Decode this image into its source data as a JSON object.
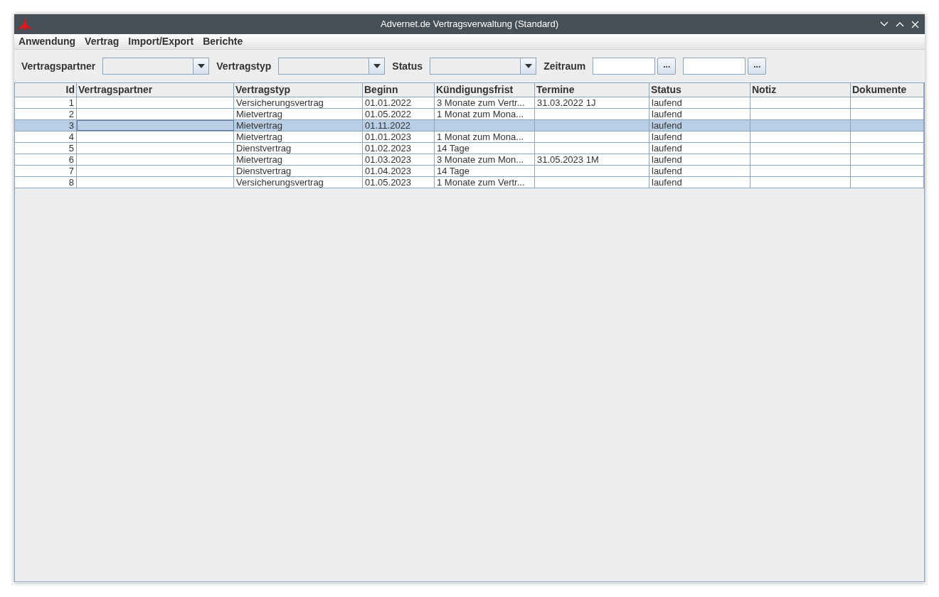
{
  "window": {
    "title": "Advernet.de Vertragsverwaltung (Standard)"
  },
  "menu": [
    "Anwendung",
    "Vertrag",
    "Import/Export",
    "Berichte"
  ],
  "filters": [
    {
      "label": "Vertragspartner",
      "kind": "combo"
    },
    {
      "label": "Vertragstyp",
      "kind": "combo"
    },
    {
      "label": "Status",
      "kind": "combo"
    },
    {
      "label": "Zeitraum",
      "kind": "range",
      "buttons": [
        "...",
        "..."
      ]
    }
  ],
  "table": {
    "columns": [
      "Id",
      "Vertragspartner",
      "Vertragstyp",
      "Beginn",
      "Kündigungsfrist",
      "Termine",
      "Status",
      "Notiz",
      "Dokumente"
    ],
    "rows": [
      {
        "selected": false,
        "id": "1",
        "vertragstyp": "Versicherungsvertrag",
        "beginn": "01.01.2022",
        "kuendigungsfrist": "3 Monate zum Vertr...",
        "termine": "31.03.2022 1J",
        "status": "laufend"
      },
      {
        "selected": false,
        "id": "2",
        "vertragstyp": "Mietvertrag",
        "beginn": "01.05.2022",
        "kuendigungsfrist": "1 Monat zum Mona...",
        "status": "laufend"
      },
      {
        "selected": true,
        "id": "3",
        "vertragstyp": "Mietvertrag",
        "beginn": "01.11.2022",
        "status": "laufend"
      },
      {
        "selected": false,
        "id": "4",
        "vertragstyp": "Mietvertrag",
        "beginn": "01.01.2023",
        "kuendigungsfrist": "1 Monat zum Mona...",
        "status": "laufend"
      },
      {
        "selected": false,
        "id": "5",
        "vertragstyp": "Dienstvertrag",
        "beginn": "01.02.2023",
        "kuendigungsfrist": "14 Tage",
        "status": "laufend"
      },
      {
        "selected": false,
        "id": "6",
        "vertragstyp": "Mietvertrag",
        "beginn": "01.03.2023",
        "kuendigungsfrist": "3 Monate zum Mon...",
        "termine": "31.05.2023 1M",
        "status": "laufend"
      },
      {
        "selected": false,
        "id": "7",
        "vertragstyp": "Dienstvertrag",
        "beginn": "01.04.2023",
        "kuendigungsfrist": "14 Tage",
        "status": "laufend"
      },
      {
        "selected": false,
        "id": "8",
        "vertragstyp": "Versicherungsvertrag",
        "beginn": "01.05.2023",
        "kuendigungsfrist": "1 Monate zum Vertr...",
        "status": "laufend"
      }
    ]
  }
}
